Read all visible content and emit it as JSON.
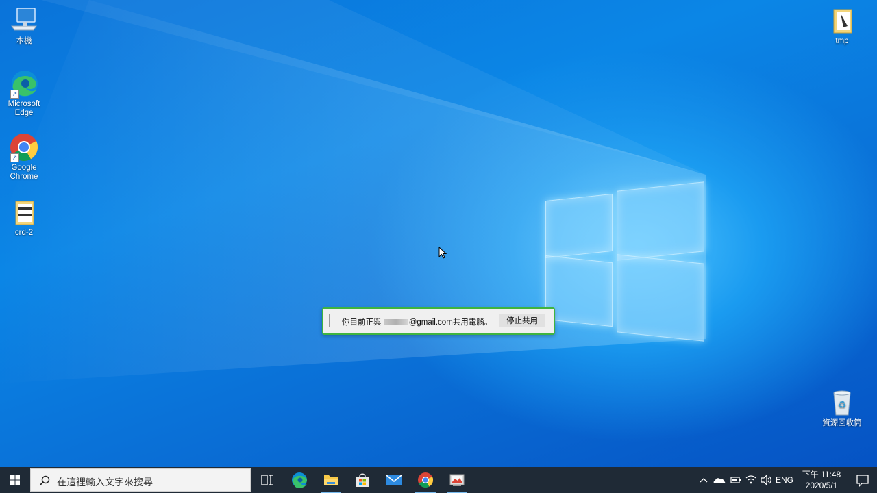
{
  "desktop": {
    "icons_left": [
      {
        "label": "本機",
        "icon": "this-pc-icon"
      },
      {
        "label": "Microsoft Edge",
        "icon": "edge-icon",
        "shortcut": true
      },
      {
        "label": "Google Chrome",
        "icon": "chrome-icon",
        "shortcut": true
      },
      {
        "label": "crd-2",
        "icon": "folder-icon"
      }
    ],
    "icons_right": [
      {
        "label": "tmp",
        "icon": "folder-icon"
      },
      {
        "label": "資源回收筒",
        "icon": "recycle-bin-icon"
      }
    ]
  },
  "share_bar": {
    "message_prefix": "你目前正與",
    "message_suffix": "@gmail.com共用電腦。",
    "stop_button": "停止共用"
  },
  "taskbar": {
    "search_placeholder": "在這裡輸入文字來搜尋",
    "pinned": [
      "task-view-icon",
      "edge-icon",
      "file-explorer-icon",
      "microsoft-store-icon",
      "mail-icon",
      "chrome-icon",
      "remote-desktop-icon"
    ],
    "tray": {
      "language": "ENG",
      "time": "下午 11:48",
      "date": "2020/5/1"
    }
  },
  "colors": {
    "desktop_blue": "#0a78dc",
    "taskbar": "#1f2a36",
    "share_border": "#3fb43f"
  }
}
